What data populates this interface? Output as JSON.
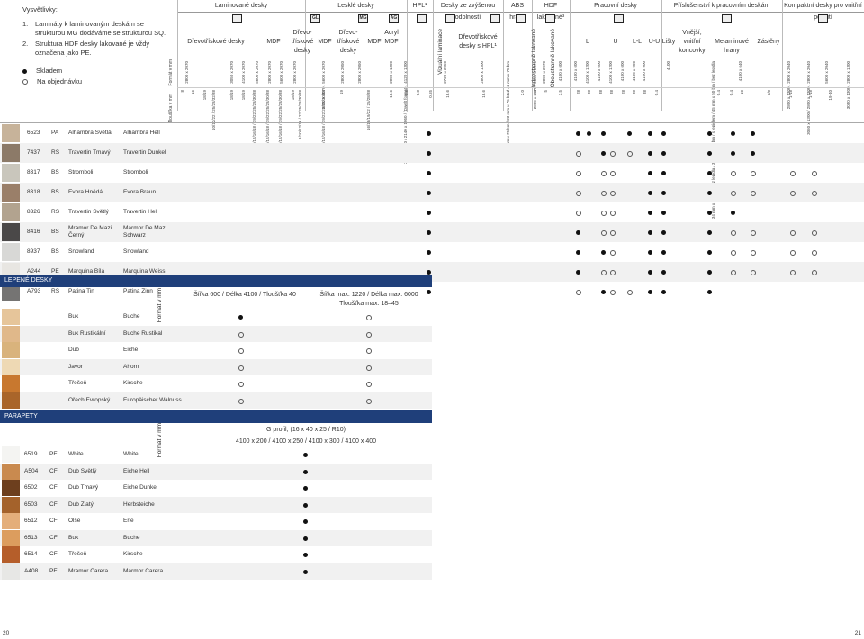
{
  "legend": {
    "title": "Vysvětlivky:",
    "notes": [
      {
        "n": "1.",
        "text": "Lamináty k laminovaným deskám se strukturou MG dodáváme se strukturou SQ."
      },
      {
        "n": "2.",
        "text": "Struktura HDF desky lakované je vždy označena jako PE."
      }
    ],
    "stock": "Skladem",
    "order": "Na objednávku"
  },
  "groups": [
    "Laminované desky",
    "Lesklé desky",
    "HPL¹",
    "Desky ze zvýšenou odolností",
    "ABS hrany",
    "HDF lakované³",
    "Pracovní desky",
    "Příslušenství k pracovním deskám",
    "Kompaktní desky pro vnitřní použití"
  ],
  "icons": {
    "gl": "GL",
    "mg": "MG",
    "ag": "AG"
  },
  "subheaders": {
    "drevo1": "Dřevotřískové desky",
    "mdf1": "MDF",
    "drevo2": "Dřevo-třískové desky",
    "mdf2": "MDF",
    "drevo3": "Dřevo-třískové desky",
    "mdf3": "MDF",
    "acryl": "Acryl MDF",
    "vizual": "Vizuální laminace",
    "drevo_hpl": "Dřevotřískové desky s HPL¹",
    "jedno": "Jednostranně lakované",
    "obou": "Oboustranně lakované",
    "l": "L",
    "u": "U",
    "ll": "L-L",
    "uu": "U-U",
    "listy": "Lišty",
    "vnejsi": "Vnější, vnitřní koncovky",
    "melamin": "Melaminové hrany",
    "zastery": "Zástěny"
  },
  "format_label": "Formát v mm",
  "thickness_label": "Tloušťka v mm",
  "formats": [
    "2800 x 2070",
    "3050 x 2070",
    "4100 x 2070",
    "5600 x 2070",
    "2800 x 2070",
    "5600 x 2070",
    "2800 x 2070",
    "2800 x 2070 / 5600 x 2070",
    "2800 x 2050",
    "2800 x 2050",
    "2800 x 1300",
    "2800 x 1220 / 2140 x 1050 / (Dwelt format) / 4120 x 1300",
    "2720 x 2050",
    "2800 x 1300",
    "23 mm x 75 bm / 23 mm x 75 bm / 42 mm x 75 bm",
    "2800 x 2070 / 2800 x 2070",
    "2800 x 2070",
    "4100 x 600",
    "4100 x 600",
    "4100 x 1200",
    "4100 x 600",
    "4100 x 1200",
    "4100 x 600",
    "4100 x 900",
    "4100 x 900",
    "4100",
    "34 mm x 50 bm / bez lepidla / 34 mm x 50 bm / s lepidlem / 45 mm x 50 bm / bez lepidla",
    "4100 x 640",
    "2800 x 1300 / 2800 x 2040",
    "3050 x 1300 / 2800 x 1300 / 2800 x 2040",
    "5600 x 2040",
    "3050 x 1300 / 2800 x 1300"
  ],
  "thickness": [
    "8",
    "16",
    "18/19",
    "10/12/22 / 25/28/32/38",
    "18/19",
    "18/19",
    "8/10/12/16/18 / 19/22/25/28/30/38",
    "8/10/12/16/18 / 19/22/25/28/30/38",
    "8/10/12/16/18 / 19/22/25/28/30/38",
    "18/19",
    "8/10/12/16 / 22/25/28/30/38",
    "8/10/12/16/18 / 19/22/25/28/30/38",
    "19",
    "16/18/19/22 / 25/28/38",
    "18.6",
    "0.8",
    "0.8",
    "0.65",
    "18.6",
    "18.6",
    "1.3",
    "2.0",
    "3",
    "5",
    "3.5",
    "28",
    "38",
    "38",
    "38",
    "28",
    "38",
    "38",
    "0.4",
    "0.4",
    "0.4",
    "10",
    "6/8",
    "1-18",
    "1-18",
    "19-40"
  ],
  "decors": [
    {
      "code": "6523",
      "str": "PA",
      "cz": "Alhambra Světlá",
      "de": "Alhambra Hell",
      "color": "#c7b39a",
      "marks": {
        "hpl": "dot",
        "pd": [
          "dot",
          "dot",
          "dot",
          "",
          "dot",
          "",
          "dot",
          "dot"
        ],
        "acc": [
          "dot",
          "dot",
          "dot"
        ]
      }
    },
    {
      "code": "7437",
      "str": "RS",
      "cz": "Travertin Tmavý",
      "de": "Travertin Dunkel",
      "color": "#8c7a68",
      "marks": {
        "hpl": "dot",
        "pd": [
          "ring",
          "",
          "dot",
          "ring",
          "ring",
          "",
          "dot",
          "dot"
        ],
        "acc": [
          "dot",
          "dot",
          "dot"
        ]
      }
    },
    {
      "code": "8317",
      "str": "BS",
      "cz": "Stromboli",
      "de": "Stromboli",
      "color": "#c9c6bc",
      "marks": {
        "hpl": "dot",
        "pd": [
          "ring",
          "",
          "ring",
          "ring",
          "",
          "",
          "dot",
          "dot"
        ],
        "acc": [
          "dot",
          "ring",
          "ring",
          "ring",
          "ring"
        ]
      }
    },
    {
      "code": "8318",
      "str": "BS",
      "cz": "Evora Hnědá",
      "de": "Evora Braun",
      "color": "#9a7f69",
      "marks": {
        "hpl": "dot",
        "pd": [
          "ring",
          "",
          "ring",
          "ring",
          "",
          "",
          "dot",
          "dot"
        ],
        "acc": [
          "dot",
          "ring",
          "ring",
          "ring",
          "ring"
        ]
      }
    },
    {
      "code": "8326",
      "str": "RS",
      "cz": "Travertin Světlý",
      "de": "Travertin Hell",
      "color": "#b2a38f",
      "marks": {
        "hpl": "dot",
        "pd": [
          "ring",
          "",
          "ring",
          "ring",
          "",
          "",
          "dot",
          "dot"
        ],
        "acc": [
          "dot",
          "dot"
        ]
      }
    },
    {
      "code": "8416",
      "str": "BS",
      "cz": "Mramor De Mazi Černý",
      "de": "Marmor De Mazi Schwarz",
      "color": "#4a4848",
      "marks": {
        "hpl": "dot",
        "pd": [
          "dot",
          "",
          "ring",
          "ring",
          "",
          "",
          "dot",
          "dot"
        ],
        "acc": [
          "dot",
          "ring",
          "ring",
          "ring",
          "ring"
        ]
      }
    },
    {
      "code": "8937",
      "str": "BS",
      "cz": "Snowland",
      "de": "Snowland",
      "color": "#d8d8d6",
      "marks": {
        "hpl": "dot",
        "pd": [
          "dot",
          "",
          "dot",
          "ring",
          "",
          "",
          "dot",
          "dot"
        ],
        "acc": [
          "dot",
          "ring",
          "ring",
          "ring",
          "ring"
        ]
      }
    },
    {
      "code": "A244",
      "str": "PE",
      "cz": "Marquina Bílá",
      "de": "Marquina Weiss",
      "color": "#e8e6e2",
      "marks": {
        "hpl": "dot",
        "pd": [
          "dot",
          "",
          "ring",
          "ring",
          "",
          "",
          "dot",
          "dot"
        ],
        "acc": [
          "dot",
          "ring",
          "ring",
          "ring",
          "ring"
        ]
      }
    },
    {
      "code": "A793",
      "str": "RS",
      "cz": "Patina Tin",
      "de": "Patina Zinn",
      "color": "#757473",
      "marks": {
        "hpl": "dot",
        "pd": [
          "ring",
          "",
          "dot",
          "ring",
          "ring",
          "",
          "dot",
          "dot"
        ],
        "acc": [
          "dot"
        ]
      }
    }
  ],
  "glued": {
    "title": "LEPENÉ DESKY",
    "format_label": "Formát v mm",
    "col1": "Šířka 600 / Délka 4100 / Tloušťka 40",
    "col2": "Šířka max. 1220 / Délka max. 6000 Tloušťka max. 18–45",
    "rows": [
      {
        "cz": "Buk",
        "de": "Buche",
        "color": "#e6c59a",
        "m1": "dot",
        "m2": "ring"
      },
      {
        "cz": "Buk Rustikální",
        "de": "Buche Rustikal",
        "color": "#e0b88a",
        "m1": "ring",
        "m2": "ring"
      },
      {
        "cz": "Dub",
        "de": "Eiche",
        "color": "#d9b37c",
        "m1": "ring",
        "m2": "ring"
      },
      {
        "cz": "Javor",
        "de": "Ahorn",
        "color": "#eed9b4",
        "m1": "ring",
        "m2": "ring"
      },
      {
        "cz": "Třešeň",
        "de": "Kirsche",
        "color": "#c8782f",
        "m1": "ring",
        "m2": "ring"
      },
      {
        "cz": "Ořech Evropský",
        "de": "Europäischer Walnuss",
        "color": "#a9652a",
        "m1": "ring",
        "m2": "ring"
      }
    ]
  },
  "battens": {
    "title": "PARAPETY",
    "format_label": "Formát v mm",
    "profile": "G profil, (16 x 40 x 25 / R10)",
    "sizes": "4100 x 200 / 4100 x 250 / 4100 x 300 / 4100 x 400",
    "rows": [
      {
        "code": "6519",
        "str": "PE",
        "cz": "White",
        "de": "White",
        "color": "#f4f4f2"
      },
      {
        "code": "A504",
        "str": "CF",
        "cz": "Dub Světlý",
        "de": "Eiche Hell",
        "color": "#c98a4f"
      },
      {
        "code": "6502",
        "str": "CF",
        "cz": "Dub Tmavý",
        "de": "Eiche Dunkel",
        "color": "#6d3f1e"
      },
      {
        "code": "6503",
        "str": "CF",
        "cz": "Dub Zlatý",
        "de": "Herbsteiche",
        "color": "#a4622b"
      },
      {
        "code": "6512",
        "str": "CF",
        "cz": "Olše",
        "de": "Erle",
        "color": "#e4ae7a"
      },
      {
        "code": "6513",
        "str": "CF",
        "cz": "Buk",
        "de": "Buche",
        "color": "#dc9d5e"
      },
      {
        "code": "6514",
        "str": "CF",
        "cz": "Třešeň",
        "de": "Kirsche",
        "color": "#b55e2a"
      },
      {
        "code": "A408",
        "str": "PE",
        "cz": "Mramor Carera",
        "de": "Marmor Carera",
        "color": "#e7e7e5"
      }
    ]
  },
  "pages": {
    "left": "20",
    "right": "21"
  }
}
